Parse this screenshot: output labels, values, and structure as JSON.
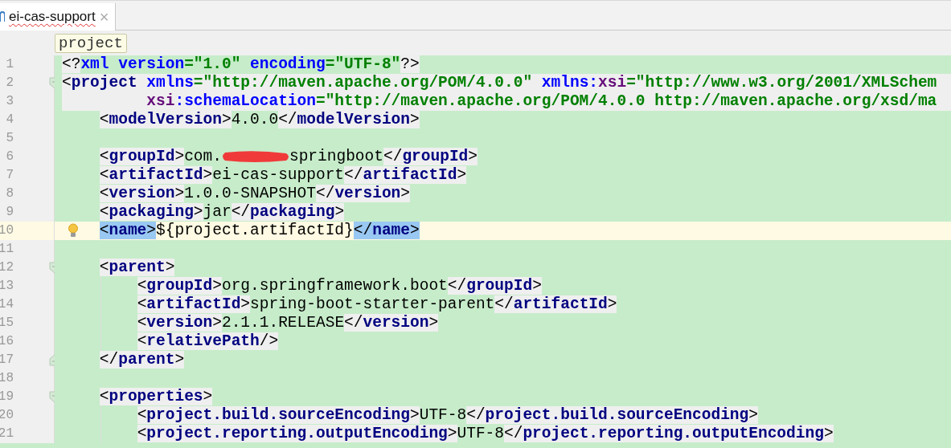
{
  "tabs": [
    {
      "label": "ei-cas-support",
      "close": "×",
      "selected": true,
      "misspelled": true
    }
  ],
  "breadcrumb": {
    "label": "project"
  },
  "editor": {
    "lines": [
      {
        "number": "1",
        "segments": [
          {
            "shaded": true,
            "tokens": [
              {
                "kind": "punct",
                "text": "<?"
              }
            ]
          },
          {
            "shaded": false,
            "tokens": [
              {
                "kind": "attr",
                "text": "xml version"
              },
              {
                "kind": "str",
                "text": "=\"1.0\""
              },
              {
                "kind": "attr",
                "text": " encoding"
              },
              {
                "kind": "str",
                "text": "=\"UTF-8\""
              }
            ]
          },
          {
            "shaded": true,
            "tokens": [
              {
                "kind": "punct",
                "text": "?>"
              }
            ]
          }
        ]
      },
      {
        "number": "2",
        "fold_start": true,
        "shaded": true,
        "segments": [
          {
            "tokens": [
              {
                "kind": "punct",
                "text": "<"
              },
              {
                "kind": "tag",
                "text": "project"
              },
              {
                "kind": "attr",
                "text": " xmlns"
              },
              {
                "kind": "str",
                "text": "=\"http://maven.apache.org/POM/4.0.0\""
              },
              {
                "kind": "attr",
                "text": " xmlns:"
              },
              {
                "kind": "ns",
                "text": "xsi"
              },
              {
                "kind": "str",
                "text": "=\"http://www.w3.org/2001/XMLSchem"
              }
            ]
          }
        ]
      },
      {
        "number": "3",
        "shaded": true,
        "segments": [
          {
            "tokens": [
              {
                "kind": "ns",
                "text": "         xsi"
              },
              {
                "kind": "attr",
                "text": ":schemaLocation"
              },
              {
                "kind": "str",
                "text": "=\"http://maven.apache.org/POM/4.0.0 http://maven.apache.org/xsd/ma"
              }
            ]
          }
        ]
      },
      {
        "number": "4",
        "segments": [
          {
            "shaded": true,
            "tokens": [
              {
                "kind": "punct",
                "text": "    <"
              },
              {
                "kind": "tag",
                "text": "modelVersion"
              },
              {
                "kind": "punct",
                "text": ">"
              }
            ]
          },
          {
            "shaded": false,
            "tokens": [
              {
                "kind": "text",
                "text": "4.0.0"
              }
            ]
          },
          {
            "shaded": true,
            "tokens": [
              {
                "kind": "punct",
                "text": "</"
              },
              {
                "kind": "tag",
                "text": "modelVersion"
              },
              {
                "kind": "punct",
                "text": ">"
              }
            ]
          }
        ]
      },
      {
        "number": "5"
      },
      {
        "number": "6",
        "segments": [
          {
            "shaded": true,
            "tokens": [
              {
                "kind": "punct",
                "text": "    <"
              },
              {
                "kind": "tag",
                "text": "groupId"
              },
              {
                "kind": "punct",
                "text": ">"
              }
            ]
          },
          {
            "shaded": false,
            "tokens": [
              {
                "kind": "text",
                "text": "com."
              },
              {
                "kind": "redacted"
              },
              {
                "kind": "text",
                "text": "springboot"
              }
            ]
          },
          {
            "shaded": true,
            "tokens": [
              {
                "kind": "punct",
                "text": "</"
              },
              {
                "kind": "tag",
                "text": "groupId"
              },
              {
                "kind": "punct",
                "text": ">"
              }
            ]
          }
        ]
      },
      {
        "number": "7",
        "segments": [
          {
            "shaded": true,
            "tokens": [
              {
                "kind": "punct",
                "text": "    <"
              },
              {
                "kind": "tag",
                "text": "artifactId"
              },
              {
                "kind": "punct",
                "text": ">"
              }
            ]
          },
          {
            "shaded": false,
            "tokens": [
              {
                "kind": "text",
                "text": "ei-cas-support"
              }
            ]
          },
          {
            "shaded": true,
            "tokens": [
              {
                "kind": "punct",
                "text": "</"
              },
              {
                "kind": "tag",
                "text": "artifactId"
              },
              {
                "kind": "punct",
                "text": ">"
              }
            ]
          }
        ]
      },
      {
        "number": "8",
        "segments": [
          {
            "shaded": true,
            "tokens": [
              {
                "kind": "punct",
                "text": "    <"
              },
              {
                "kind": "tag",
                "text": "version"
              },
              {
                "kind": "punct",
                "text": ">"
              }
            ]
          },
          {
            "shaded": false,
            "tokens": [
              {
                "kind": "text",
                "text": "1.0.0-SNAPSHOT"
              }
            ]
          },
          {
            "shaded": true,
            "tokens": [
              {
                "kind": "punct",
                "text": "</"
              },
              {
                "kind": "tag",
                "text": "version"
              },
              {
                "kind": "punct",
                "text": ">"
              }
            ]
          }
        ]
      },
      {
        "number": "9",
        "segments": [
          {
            "shaded": true,
            "tokens": [
              {
                "kind": "punct",
                "text": "    <"
              },
              {
                "kind": "tag",
                "text": "packaging"
              },
              {
                "kind": "punct",
                "text": ">"
              }
            ]
          },
          {
            "shaded": false,
            "tokens": [
              {
                "kind": "text",
                "text": "jar"
              }
            ]
          },
          {
            "shaded": true,
            "tokens": [
              {
                "kind": "punct",
                "text": "</"
              },
              {
                "kind": "tag",
                "text": "packaging"
              },
              {
                "kind": "punct",
                "text": ">"
              }
            ]
          }
        ]
      },
      {
        "number": "10",
        "current": true,
        "bulb": true,
        "segments": [
          {
            "matched": true,
            "tokens": [
              {
                "kind": "punct",
                "text": "    <"
              },
              {
                "kind": "tag",
                "text": "name"
              },
              {
                "kind": "punct",
                "text": ">"
              }
            ]
          },
          {
            "shaded": false,
            "tokens": [
              {
                "kind": "text",
                "text": "${project.artifactId}"
              }
            ]
          },
          {
            "matched": true,
            "tokens": [
              {
                "kind": "punct",
                "text": "</"
              },
              {
                "kind": "tag",
                "text": "name"
              },
              {
                "kind": "punct",
                "text": ">"
              }
            ]
          }
        ]
      },
      {
        "number": "11"
      },
      {
        "number": "12",
        "fold_start": true,
        "segments": [
          {
            "shaded": true,
            "tokens": [
              {
                "kind": "punct",
                "text": "    <"
              },
              {
                "kind": "tag",
                "text": "parent"
              },
              {
                "kind": "punct",
                "text": ">"
              }
            ]
          }
        ]
      },
      {
        "number": "13",
        "guide": true,
        "segments": [
          {
            "shaded": true,
            "tokens": [
              {
                "kind": "punct",
                "text": "        <"
              },
              {
                "kind": "tag",
                "text": "groupId"
              },
              {
                "kind": "punct",
                "text": ">"
              }
            ]
          },
          {
            "shaded": false,
            "tokens": [
              {
                "kind": "text",
                "text": "org.springframework.boot"
              }
            ]
          },
          {
            "shaded": true,
            "tokens": [
              {
                "kind": "punct",
                "text": "</"
              },
              {
                "kind": "tag",
                "text": "groupId"
              },
              {
                "kind": "punct",
                "text": ">"
              }
            ]
          }
        ]
      },
      {
        "number": "14",
        "guide": true,
        "segments": [
          {
            "shaded": true,
            "tokens": [
              {
                "kind": "punct",
                "text": "        <"
              },
              {
                "kind": "tag",
                "text": "artifactId"
              },
              {
                "kind": "punct",
                "text": ">"
              }
            ]
          },
          {
            "shaded": false,
            "tokens": [
              {
                "kind": "text",
                "text": "spring-boot-starter-parent"
              }
            ]
          },
          {
            "shaded": true,
            "tokens": [
              {
                "kind": "punct",
                "text": "</"
              },
              {
                "kind": "tag",
                "text": "artifactId"
              },
              {
                "kind": "punct",
                "text": ">"
              }
            ]
          }
        ]
      },
      {
        "number": "15",
        "guide": true,
        "segments": [
          {
            "shaded": true,
            "tokens": [
              {
                "kind": "punct",
                "text": "        <"
              },
              {
                "kind": "tag",
                "text": "version"
              },
              {
                "kind": "punct",
                "text": ">"
              }
            ]
          },
          {
            "shaded": false,
            "tokens": [
              {
                "kind": "text",
                "text": "2.1.1.RELEASE"
              }
            ]
          },
          {
            "shaded": true,
            "tokens": [
              {
                "kind": "punct",
                "text": "</"
              },
              {
                "kind": "tag",
                "text": "version"
              },
              {
                "kind": "punct",
                "text": ">"
              }
            ]
          }
        ]
      },
      {
        "number": "16",
        "guide": true,
        "segments": [
          {
            "shaded": true,
            "tokens": [
              {
                "kind": "punct",
                "text": "        <"
              },
              {
                "kind": "tag",
                "text": "relativePath"
              },
              {
                "kind": "punct",
                "text": "/>"
              }
            ]
          }
        ]
      },
      {
        "number": "17",
        "fold_end": true,
        "segments": [
          {
            "shaded": true,
            "tokens": [
              {
                "kind": "punct",
                "text": "    </"
              },
              {
                "kind": "tag",
                "text": "parent"
              },
              {
                "kind": "punct",
                "text": ">"
              }
            ]
          }
        ]
      },
      {
        "number": "18"
      },
      {
        "number": "19",
        "fold_start": true,
        "segments": [
          {
            "shaded": true,
            "tokens": [
              {
                "kind": "punct",
                "text": "    <"
              },
              {
                "kind": "tag",
                "text": "properties"
              },
              {
                "kind": "punct",
                "text": ">"
              }
            ]
          }
        ]
      },
      {
        "number": "20",
        "guide": true,
        "segments": [
          {
            "shaded": true,
            "tokens": [
              {
                "kind": "punct",
                "text": "        <"
              },
              {
                "kind": "tag",
                "text": "project.build.sourceEncoding"
              },
              {
                "kind": "punct",
                "text": ">"
              }
            ]
          },
          {
            "shaded": false,
            "tokens": [
              {
                "kind": "text",
                "text": "UTF-8"
              }
            ]
          },
          {
            "shaded": true,
            "tokens": [
              {
                "kind": "punct",
                "text": "</"
              },
              {
                "kind": "tag",
                "text": "project.build.sourceEncoding"
              },
              {
                "kind": "punct",
                "text": ">"
              }
            ]
          }
        ]
      },
      {
        "number": "21",
        "guide": true,
        "segments": [
          {
            "shaded": true,
            "tokens": [
              {
                "kind": "punct",
                "text": "        <"
              },
              {
                "kind": "tag",
                "text": "project.reporting.outputEncoding"
              },
              {
                "kind": "punct",
                "text": ">"
              }
            ]
          },
          {
            "shaded": false,
            "tokens": [
              {
                "kind": "text",
                "text": "UTF-8"
              }
            ]
          },
          {
            "shaded": true,
            "tokens": [
              {
                "kind": "punct",
                "text": "</"
              },
              {
                "kind": "tag",
                "text": "project.reporting.outputEncoding"
              },
              {
                "kind": "punct",
                "text": ">"
              }
            ]
          }
        ]
      }
    ]
  }
}
